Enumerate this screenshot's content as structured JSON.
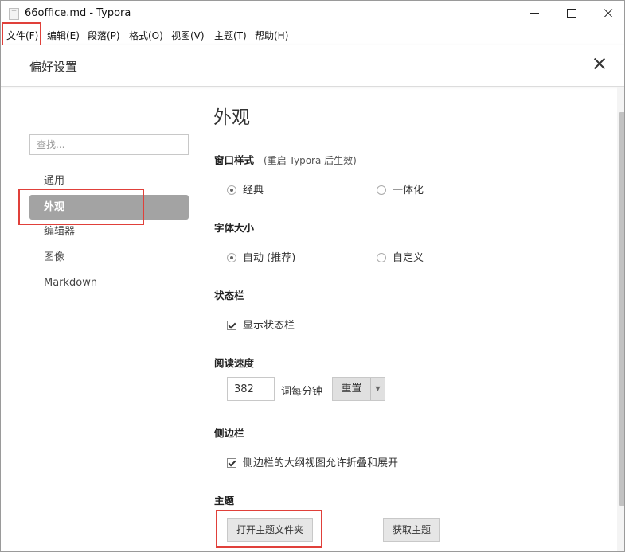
{
  "window": {
    "title": "66office.md - Typora",
    "app_icon_glyph": "T"
  },
  "menubar": {
    "items": [
      {
        "label": "文件(F)"
      },
      {
        "label": "编辑(E)"
      },
      {
        "label": "段落(P)"
      },
      {
        "label": "格式(O)"
      },
      {
        "label": "视图(V)"
      },
      {
        "label": "主题(T)"
      },
      {
        "label": "帮助(H)"
      }
    ]
  },
  "preferences": {
    "title": "偏好设置",
    "search_placeholder": "查找...",
    "nav": [
      {
        "label": "通用",
        "active": false
      },
      {
        "label": "外观",
        "active": true
      },
      {
        "label": "编辑器",
        "active": false
      },
      {
        "label": "图像",
        "active": false
      },
      {
        "label": "Markdown",
        "active": false
      }
    ]
  },
  "appearance": {
    "heading": "外观",
    "window_style": {
      "title": "窗口样式",
      "note": "(重启 Typora 后生效)",
      "options": [
        {
          "label": "经典",
          "selected": true
        },
        {
          "label": "一体化",
          "selected": false
        }
      ]
    },
    "font_size": {
      "title": "字体大小",
      "options": [
        {
          "label": "自动 (推荐)",
          "selected": true
        },
        {
          "label": "自定义",
          "selected": false
        }
      ]
    },
    "status_bar": {
      "title": "状态栏",
      "checkbox_label": "显示状态栏",
      "checked": true
    },
    "reading_speed": {
      "title": "阅读速度",
      "value": "382",
      "unit": "词每分钟",
      "reset_label": "重置",
      "dropdown_glyph": "▼"
    },
    "sidebar": {
      "title": "侧边栏",
      "checkbox_label": "侧边栏的大纲视图允许折叠和展开",
      "checked": true
    },
    "theme": {
      "title": "主题",
      "open_folder_label": "打开主题文件夹",
      "get_themes_label": "获取主题"
    }
  },
  "colors": {
    "highlight_box": "#e0403a",
    "active_nav_bg": "#a3a3a3"
  }
}
